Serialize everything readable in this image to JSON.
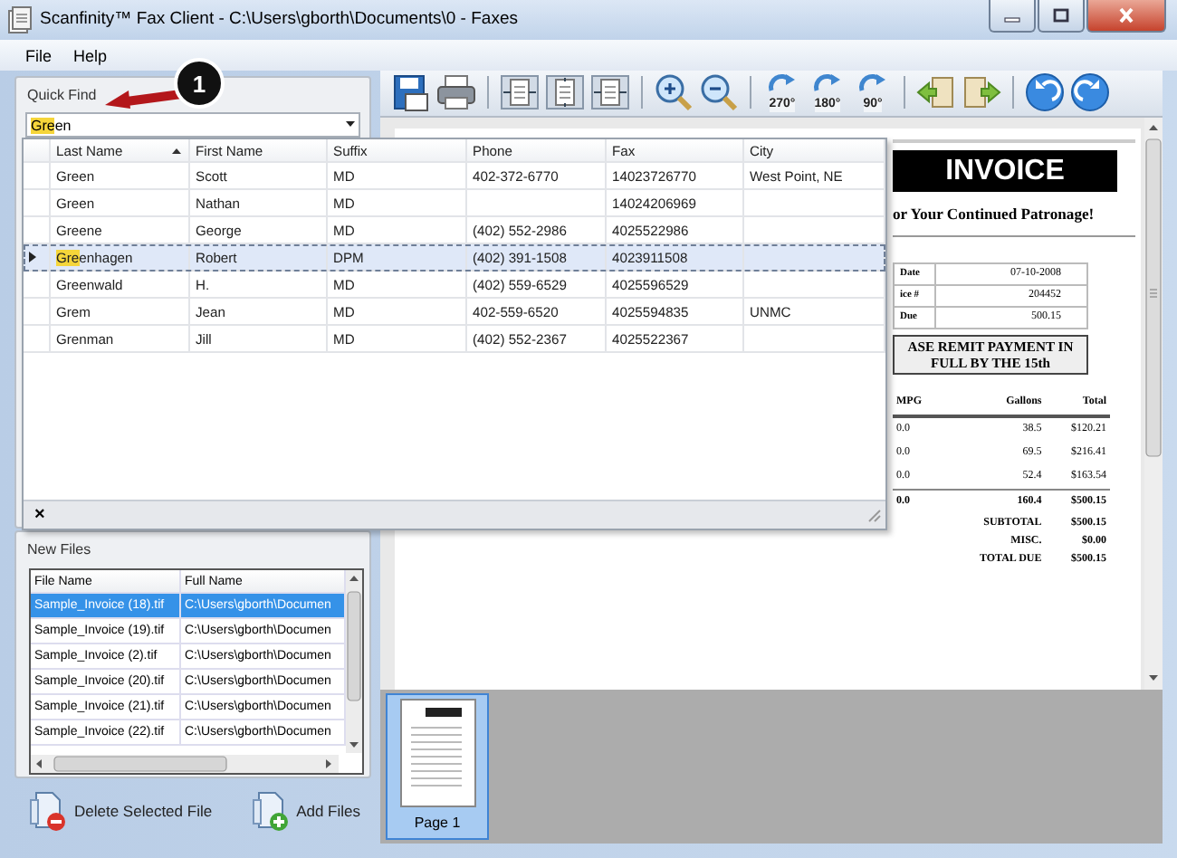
{
  "window": {
    "title": "Scanfinity™ Fax Client - C:\\Users\\gborth\\Documents\\0 - Faxes"
  },
  "menu": [
    "File",
    "Help"
  ],
  "quick_find": {
    "title": "Quick Find",
    "match": "Gre",
    "rest": "en"
  },
  "popup": {
    "columns": [
      {
        "label": "Last Name",
        "sorted": true
      },
      {
        "label": "First Name",
        "sorted": false
      },
      {
        "label": "Suffix",
        "sorted": false
      },
      {
        "label": "Phone",
        "sorted": false
      },
      {
        "label": "Fax",
        "sorted": false
      },
      {
        "label": "City",
        "sorted": false
      }
    ],
    "rows": [
      {
        "last_name": "Green",
        "first_name": "Scott",
        "suffix": "MD",
        "phone": "402-372-6770",
        "fax": "14023726770",
        "city": "West Point, NE",
        "selected": false
      },
      {
        "last_name": "Green",
        "first_name": "Nathan",
        "suffix": "MD",
        "fax": "14024206969",
        "selected": false
      },
      {
        "last_name": "Greene",
        "first_name": "George",
        "suffix": "MD",
        "phone": "(402) 552-2986",
        "fax": "4025522986",
        "selected": false
      },
      {
        "last_name": {
          "match": "Gre",
          "rest": "enhagen"
        },
        "first_name": "Robert",
        "suffix": "DPM",
        "phone": "(402) 391-1508",
        "fax": "4023911508",
        "selected": true
      },
      {
        "last_name": "Greenwald",
        "first_name": "H.",
        "suffix": "MD",
        "phone": "(402) 559-6529",
        "fax": "4025596529",
        "selected": false
      },
      {
        "last_name": "Grem",
        "first_name": "Jean",
        "suffix": "MD",
        "phone": "402-559-6520",
        "fax": "4025594835",
        "city": "UNMC",
        "selected": false
      },
      {
        "last_name": "Grenman",
        "first_name": "Jill",
        "suffix": "MD",
        "phone": "(402) 552-2367",
        "fax": "4025522367",
        "selected": false
      }
    ],
    "close_label": "×"
  },
  "new_files": {
    "title": "New Files",
    "columns": [
      "File Name",
      "Full Name"
    ],
    "rows": [
      {
        "file_name": "Sample_Invoice (18).tif",
        "full_name": "C:\\Users\\gborth\\Documen",
        "selected": true
      },
      {
        "file_name": "Sample_Invoice (19).tif",
        "full_name": "C:\\Users\\gborth\\Documen",
        "selected": false
      },
      {
        "file_name": "Sample_Invoice (2).tif",
        "full_name": "C:\\Users\\gborth\\Documen",
        "selected": false
      },
      {
        "file_name": "Sample_Invoice (20).tif",
        "full_name": "C:\\Users\\gborth\\Documen",
        "selected": false
      },
      {
        "file_name": "Sample_Invoice (21).tif",
        "full_name": "C:\\Users\\gborth\\Documen",
        "selected": false
      },
      {
        "file_name": "Sample_Invoice (22).tif",
        "full_name": "C:\\Users\\gborth\\Documen",
        "selected": false
      }
    ]
  },
  "file_buttons": [
    {
      "label": "Delete Selected File",
      "kind": "delete"
    },
    {
      "label": "Add Files",
      "kind": "add"
    }
  ],
  "toolbar": {
    "rotate": [
      "270°",
      "180°",
      "90°"
    ]
  },
  "invoice": {
    "heading": "INVOICE",
    "tagline": "or Your Continued Patronage!",
    "details": [
      {
        "label": "Date",
        "value": "07-10-2008"
      },
      {
        "label": "ice #",
        "value": "204452"
      },
      {
        "label": "Due",
        "value": "500.15"
      }
    ],
    "notice": [
      "ASE REMIT PAYMENT IN",
      "FULL BY THE 15th"
    ],
    "columns": [
      "MPG",
      "Gallons",
      "Total"
    ],
    "rows": [
      [
        "0.0",
        "38.5",
        "$120.21"
      ],
      [
        "0.0",
        "69.5",
        "$216.41"
      ],
      [
        "0.0",
        "52.4",
        "$163.54"
      ]
    ],
    "total_row": [
      "0.0",
      "160.4",
      "$500.15"
    ],
    "summary": [
      {
        "label": "SUBTOTAL",
        "value": "$500.15"
      },
      {
        "label": "MISC.",
        "value": "$0.00"
      },
      {
        "label": "TOTAL DUE",
        "value": "$500.15"
      }
    ]
  },
  "thumbnails": [
    {
      "label": "Page 1",
      "selected": true
    }
  ],
  "callout": {
    "number": "1"
  }
}
